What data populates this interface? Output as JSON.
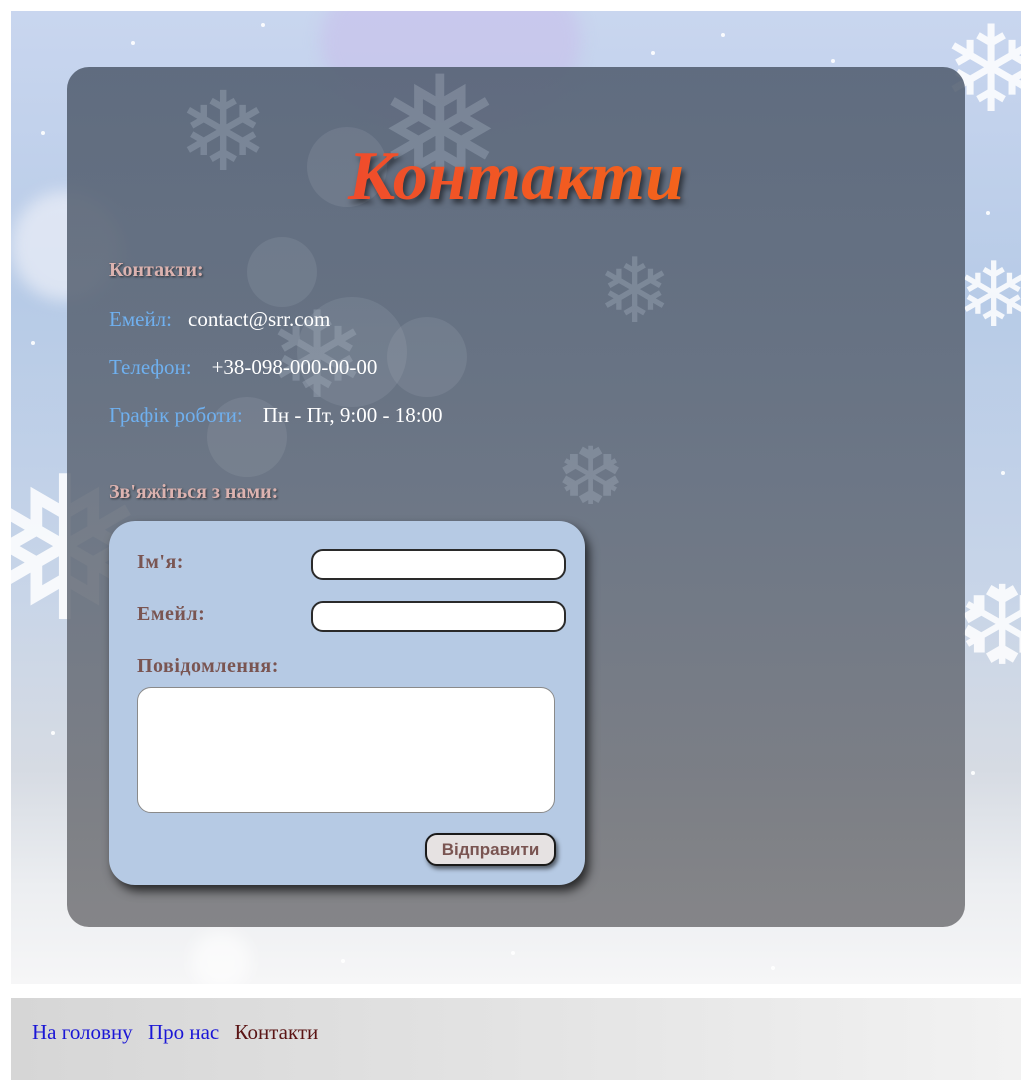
{
  "page": {
    "title": "Контакти"
  },
  "contacts": {
    "heading": "Контакти:",
    "email_label": "Емейл:",
    "email_value": "contact@srr.com",
    "phone_label": "Телефон:",
    "phone_value": "+38-098-000-00-00",
    "schedule_label": "Графік роботи:",
    "schedule_value": "Пн - Пт, 9:00 - 18:00"
  },
  "form": {
    "heading": "Зв'яжіться з нами:",
    "name_label": "Ім'я:",
    "name_value": "",
    "email_label": "Емейл:",
    "email_value": "",
    "message_label": "Повідомлення:",
    "message_value": "",
    "submit_label": "Відправити"
  },
  "footer": {
    "nav": [
      {
        "label": "На головну"
      },
      {
        "label": "Про нас"
      },
      {
        "label": "Контакти"
      }
    ]
  },
  "colors": {
    "title_gradient_start": "#e8293a",
    "title_gradient_end": "#f0761a",
    "heading": "#dcb3b0",
    "info_label": "#6fb0ef",
    "form_card": "#b6cae4",
    "form_label": "#7a5552",
    "link": "#1a16d6",
    "current_link": "#5a1414"
  },
  "icons": {
    "background_decoration": "snowflake-icon"
  }
}
